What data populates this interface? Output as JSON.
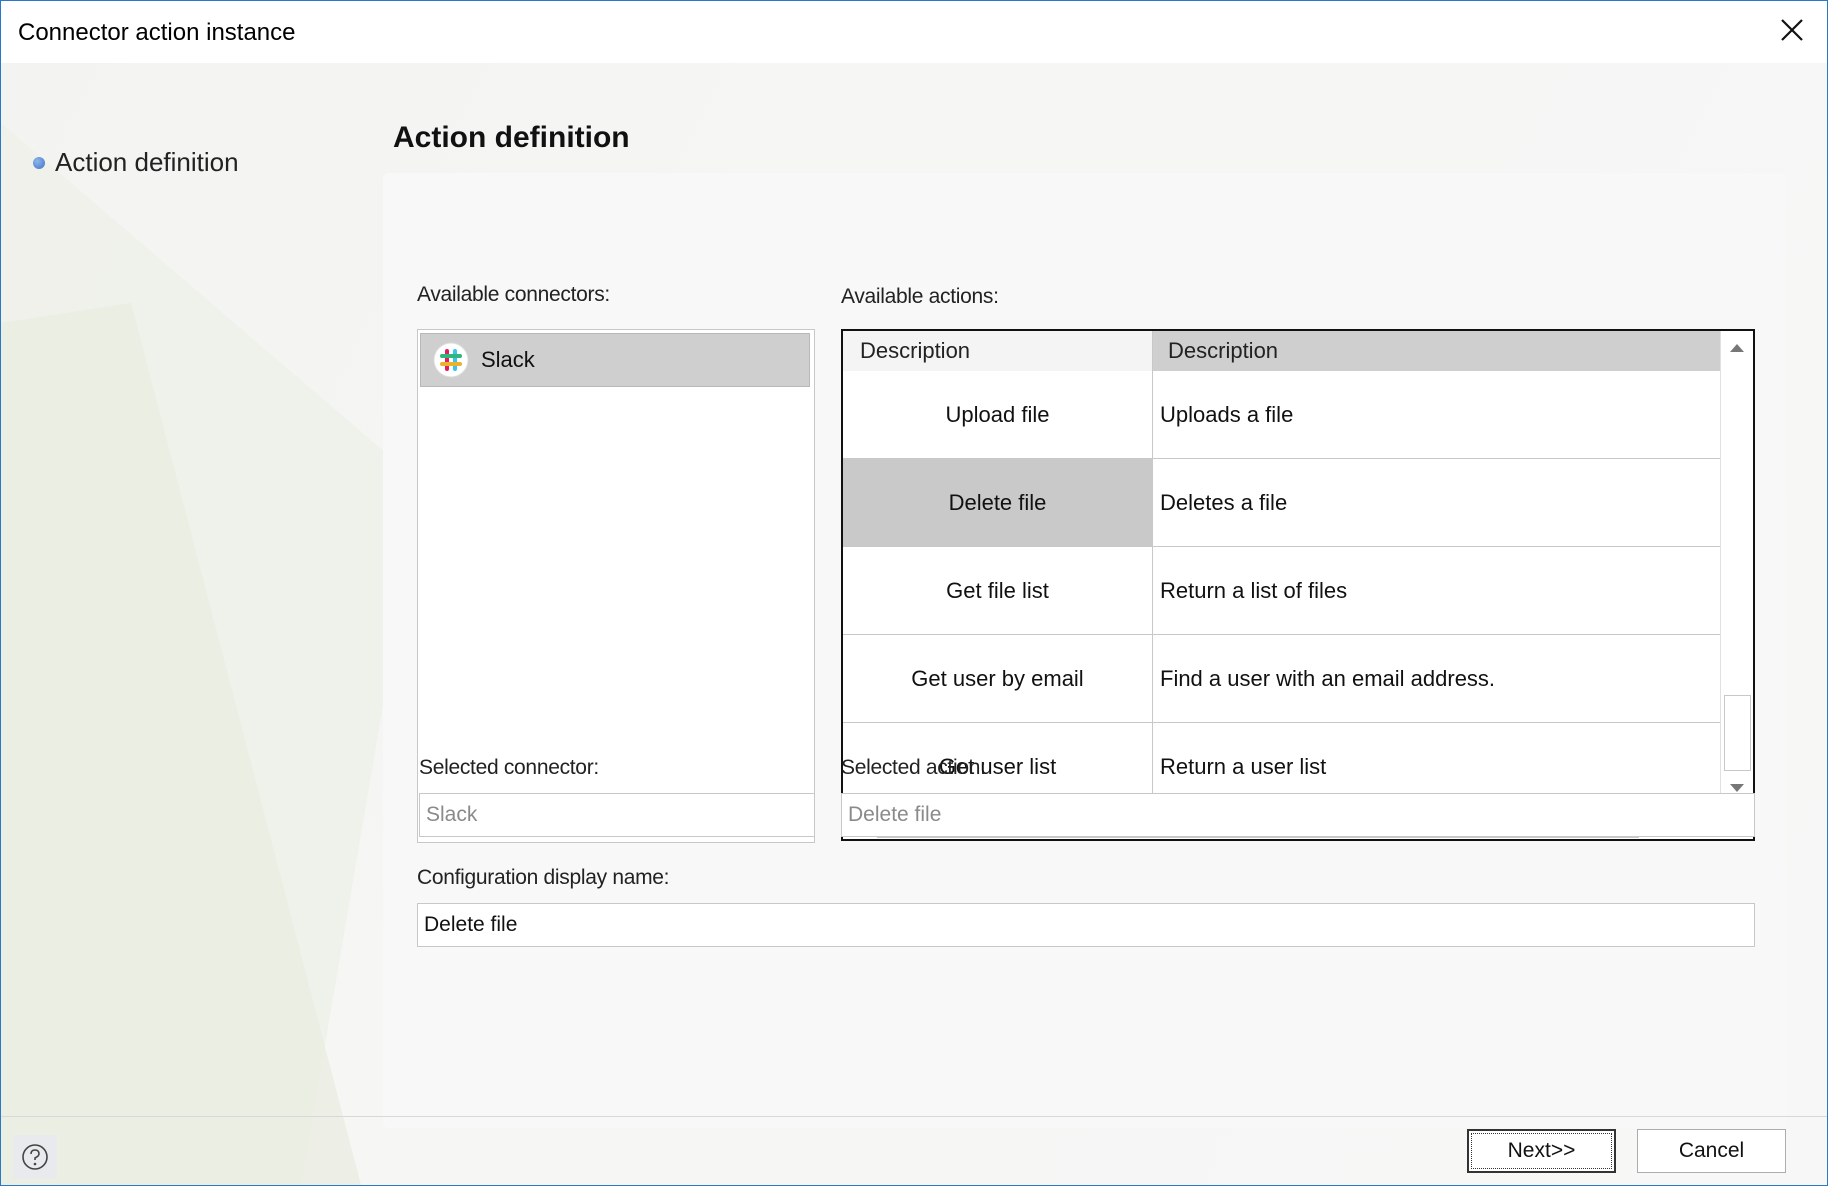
{
  "window": {
    "title": "Connector action instance"
  },
  "nav": {
    "items": [
      {
        "label": "Action definition"
      }
    ]
  },
  "page": {
    "title": "Action definition"
  },
  "connectors": {
    "label": "Available connectors:",
    "items": [
      {
        "label": "Slack",
        "icon": "slack-icon",
        "selected": true
      }
    ]
  },
  "actions": {
    "label": "Available actions:",
    "columns": [
      "Description",
      "Description"
    ],
    "rows": [
      {
        "name": "Upload file",
        "description": "Uploads a file",
        "selected": false
      },
      {
        "name": "Delete file",
        "description": "Deletes a file",
        "selected": true
      },
      {
        "name": "Get file list",
        "description": "Return a list of files",
        "selected": false
      },
      {
        "name": "Get user by email",
        "description": "Find a user with an email address.",
        "selected": false
      },
      {
        "name": "Get user list",
        "description": "Return a user list",
        "selected": false
      }
    ]
  },
  "selected_connector": {
    "label": "Selected connector:",
    "value": "Slack"
  },
  "selected_action": {
    "label": "Selected action:",
    "value": "Delete file"
  },
  "config_name": {
    "label": "Configuration display name:",
    "value": "Delete file"
  },
  "footer": {
    "next_label": "Next>>",
    "cancel_label": "Cancel",
    "help_icon": "help-icon"
  },
  "colors": {
    "window_border": "#2b78c7",
    "selection": "#c9c9c9",
    "nav_bullet": "#3f73c4"
  }
}
